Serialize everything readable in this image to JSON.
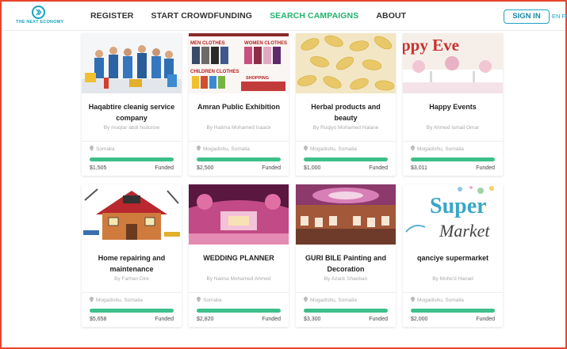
{
  "header": {
    "logo_text": "THE NEXT ECONOMY",
    "nav": [
      {
        "label": "REGISTER",
        "active": false
      },
      {
        "label": "START CROWDFUNDING",
        "active": false
      },
      {
        "label": "SEARCH CAMPAIGNS",
        "active": true
      },
      {
        "label": "ABOUT",
        "active": false
      }
    ],
    "signin_label": "SIGN IN",
    "languages": "EN FR"
  },
  "campaigns": [
    {
      "title": "Haqabtire cleanig service company",
      "author": "By muqtar abdi hudurow",
      "location": "Somalia",
      "amount": "$1,505",
      "status": "Funded",
      "image": "cleaning-staff-photo"
    },
    {
      "title": "Amran Public Exhibition",
      "author": "By Halima Mohamed Isaack",
      "location": "Mogadishu, Somalia",
      "amount": "$2,500",
      "status": "Funded",
      "image": "clothes-exhibition-photo",
      "image_text": [
        "MEN CLOTHES",
        "WOMEN CLOTHES",
        "CHILDREN CLOTHES",
        "SHOPPING"
      ]
    },
    {
      "title": "Herbal products and beauty",
      "author": "By Ruqiyo Mohamed Halane",
      "location": "Mogadishu, Somalia",
      "amount": "$1,000",
      "status": "Funded",
      "image": "capsules-photo"
    },
    {
      "title": "Happy Events",
      "author": "By Ahmed Ismail Omar",
      "location": "Mogadishu, Somalia",
      "amount": "$3,011",
      "status": "Funded",
      "image": "event-table-photo",
      "image_text": "ppy Eve"
    },
    {
      "title": "Home repairing and maintenance",
      "author": "By Farhan Dire",
      "location": "Mogadishu, Somalia",
      "amount": "$5,658",
      "status": "Funded",
      "image": "house-tools-illustration"
    },
    {
      "title": "WEDDING PLANNER",
      "author": "By Naima Mohamed Ahmed",
      "location": "Somalia",
      "amount": "$2,820",
      "status": "Funded",
      "image": "wedding-stage-photo"
    },
    {
      "title": "GURI BILE Painting and Decoration",
      "author": "By Azack Shaoban",
      "location": "Mogadishu, Somalia",
      "amount": "$3,300",
      "status": "Funded",
      "image": "hall-ceiling-photo"
    },
    {
      "title": "qanciye supermarket",
      "author": "By Mohe'd Hanad",
      "location": "Mogadishu, Somalia",
      "amount": "$2,000",
      "status": "Funded",
      "image": "supermarket-logo",
      "image_text": [
        "Super",
        "Market"
      ]
    }
  ],
  "colors": {
    "accent": "#23b36e",
    "brand": "#1aa3c4",
    "progress": "#3dbf8a",
    "frame": "#e8452c"
  }
}
